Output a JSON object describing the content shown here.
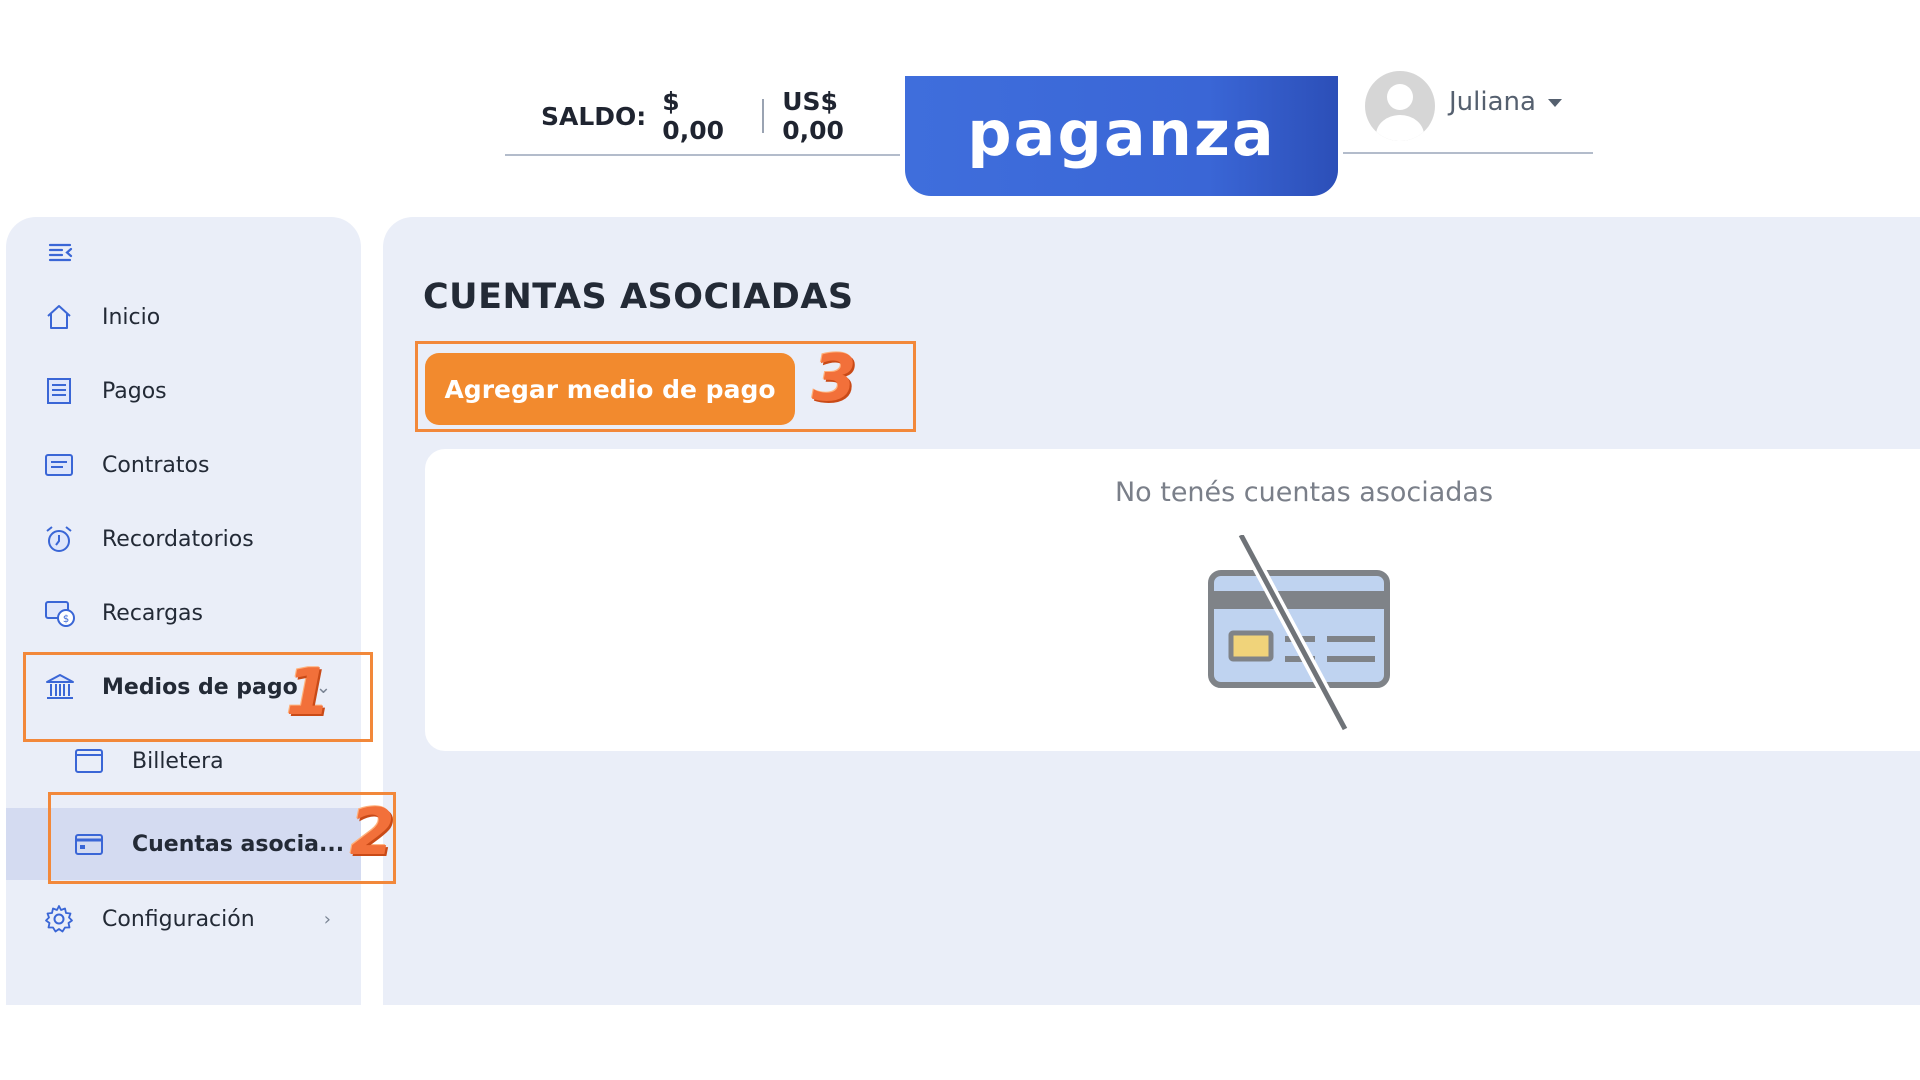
{
  "header": {
    "saldo_label": "SALDO:",
    "saldo_pesos": "$ 0,00",
    "saldo_usd": "US$ 0,00",
    "logo_text": "paganza",
    "user_name": "Juliana",
    "brand_color": "#3f6edc"
  },
  "sidebar": {
    "collapse_icon": "collapse-menu-icon",
    "items": [
      {
        "label": "Inicio",
        "icon": "home-icon"
      },
      {
        "label": "Pagos",
        "icon": "receipt-icon"
      },
      {
        "label": "Contratos",
        "icon": "document-icon"
      },
      {
        "label": "Recordatorios",
        "icon": "alarm-clock-icon"
      },
      {
        "label": "Recargas",
        "icon": "money-exchange-icon"
      },
      {
        "label": "Medios de pago",
        "icon": "bank-icon",
        "chevron": "⌄"
      },
      {
        "label": "Billetera",
        "icon": "wallet-icon"
      },
      {
        "label": "Cuentas asocia...",
        "icon": "credit-card-icon"
      },
      {
        "label": "Configuración",
        "icon": "gear-icon",
        "chevron": "›"
      }
    ]
  },
  "main": {
    "title": "CUENTAS ASOCIADAS",
    "add_button_label": "Agregar medio de pago",
    "empty_message": "No tenés cuentas asociadas",
    "empty_icon": "no-credit-card-icon",
    "accent_color": "#f28a2e"
  },
  "annotations": [
    {
      "number": "1",
      "target": "Medios de pago"
    },
    {
      "number": "2",
      "target": "Cuentas asocia..."
    },
    {
      "number": "3",
      "target": "Agregar medio de pago"
    }
  ]
}
